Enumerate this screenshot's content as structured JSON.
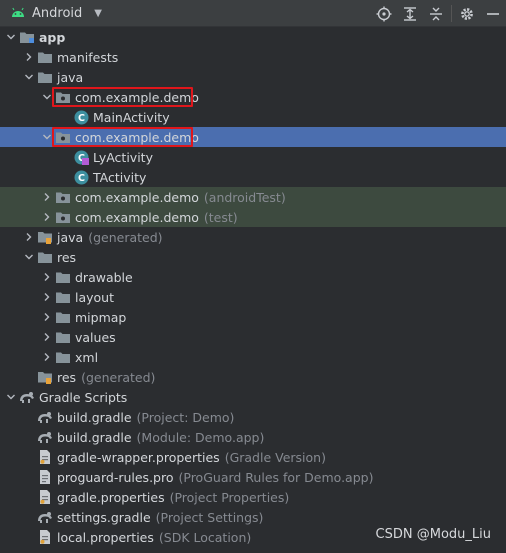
{
  "toolbar": {
    "title": "Android",
    "view_icon": "android-icon",
    "buttons": [
      "locate-icon",
      "expand-all-icon",
      "collapse-all-icon",
      "settings-icon",
      "hide-icon"
    ]
  },
  "tree": [
    {
      "label": "app",
      "hint": "",
      "level": 0,
      "arrow": "down",
      "icon": "module",
      "bold": true
    },
    {
      "label": "manifests",
      "hint": "",
      "level": 1,
      "arrow": "right",
      "icon": "folder"
    },
    {
      "label": "java",
      "hint": "",
      "level": 1,
      "arrow": "down",
      "icon": "folder"
    },
    {
      "label": "com.example.demo",
      "hint": "",
      "level": 2,
      "arrow": "down",
      "icon": "package",
      "highlight": true
    },
    {
      "label": "MainActivity",
      "hint": "",
      "level": 3,
      "arrow": "",
      "icon": "class"
    },
    {
      "label": "com.example.demo",
      "hint": "",
      "level": 2,
      "arrow": "down",
      "icon": "package",
      "highlight": true,
      "selected": true
    },
    {
      "label": "LyActivity",
      "hint": "",
      "level": 3,
      "arrow": "",
      "icon": "class-modified"
    },
    {
      "label": "TActivity",
      "hint": "",
      "level": 3,
      "arrow": "",
      "icon": "class"
    },
    {
      "label": "com.example.demo",
      "hint": "(androidTest)",
      "level": 2,
      "arrow": "right",
      "icon": "package",
      "tinted": true
    },
    {
      "label": "com.example.demo",
      "hint": "(test)",
      "level": 2,
      "arrow": "right",
      "icon": "package",
      "tinted": true
    },
    {
      "label": "java",
      "hint": "(generated)",
      "level": 1,
      "arrow": "right",
      "icon": "folder-gen"
    },
    {
      "label": "res",
      "hint": "",
      "level": 1,
      "arrow": "down",
      "icon": "folder"
    },
    {
      "label": "drawable",
      "hint": "",
      "level": 2,
      "arrow": "right",
      "icon": "folder"
    },
    {
      "label": "layout",
      "hint": "",
      "level": 2,
      "arrow": "right",
      "icon": "folder"
    },
    {
      "label": "mipmap",
      "hint": "",
      "level": 2,
      "arrow": "right",
      "icon": "folder"
    },
    {
      "label": "values",
      "hint": "",
      "level": 2,
      "arrow": "right",
      "icon": "folder"
    },
    {
      "label": "xml",
      "hint": "",
      "level": 2,
      "arrow": "right",
      "icon": "folder"
    },
    {
      "label": "res",
      "hint": "(generated)",
      "level": 1,
      "arrow": "",
      "icon": "folder-gen"
    },
    {
      "label": "Gradle Scripts",
      "hint": "",
      "level": 0,
      "arrow": "down",
      "icon": "gradle"
    },
    {
      "label": "build.gradle",
      "hint": "(Project: Demo)",
      "level": 1,
      "arrow": "",
      "icon": "gradle"
    },
    {
      "label": "build.gradle",
      "hint": "(Module: Demo.app)",
      "level": 1,
      "arrow": "",
      "icon": "gradle"
    },
    {
      "label": "gradle-wrapper.properties",
      "hint": "(Gradle Version)",
      "level": 1,
      "arrow": "",
      "icon": "properties"
    },
    {
      "label": "proguard-rules.pro",
      "hint": "(ProGuard Rules for Demo.app)",
      "level": 1,
      "arrow": "",
      "icon": "text-file"
    },
    {
      "label": "gradle.properties",
      "hint": "(Project Properties)",
      "level": 1,
      "arrow": "",
      "icon": "properties"
    },
    {
      "label": "settings.gradle",
      "hint": "(Project Settings)",
      "level": 1,
      "arrow": "",
      "icon": "gradle"
    },
    {
      "label": "local.properties",
      "hint": "(SDK Location)",
      "level": 1,
      "arrow": "",
      "icon": "properties"
    }
  ],
  "watermark": "CSDN @Modu_Liu",
  "colors": {
    "selection": "#4b6eaf",
    "highlight_box": "#e0161b",
    "folder": "#87939a",
    "class_icon": "#3d8f9f",
    "android": "#3ddc84"
  }
}
